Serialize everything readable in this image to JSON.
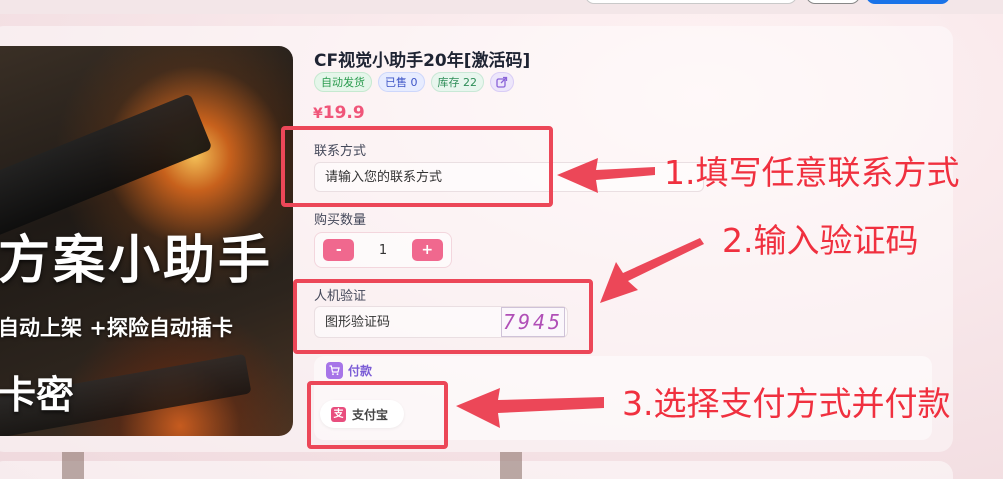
{
  "product": {
    "title": "CF视觉小助手20年[激活码]",
    "tags": [
      "自动发货",
      "已售 0",
      "库存 22"
    ],
    "price_currency": "¥",
    "price_value": "19.9",
    "image_text": {
      "title": "方案小助手",
      "subtitle": "自动上架 +探险自动插卡",
      "kami": "卡密"
    }
  },
  "form": {
    "contact_label": "联系方式",
    "contact_placeholder": "请输入您的联系方式",
    "quantity_label": "购买数量",
    "quantity_minus": "-",
    "quantity_value": "1",
    "quantity_plus": "+",
    "captcha_label": "人机验证",
    "captcha_placeholder": "图形验证码",
    "captcha_code": "7945"
  },
  "payment": {
    "section_label": "付款",
    "methods": [
      {
        "label": "支付宝",
        "icon": "alipay-icon"
      }
    ]
  },
  "annotations": [
    "1.填写任意联系方式",
    "2.输入验证码",
    "3.选择支付方式并付款"
  ],
  "colors": {
    "accent_pink": "#f0688e",
    "price": "#f05579",
    "annotation_red": "#ec4758",
    "pay_purple": "#7b5cd6"
  }
}
